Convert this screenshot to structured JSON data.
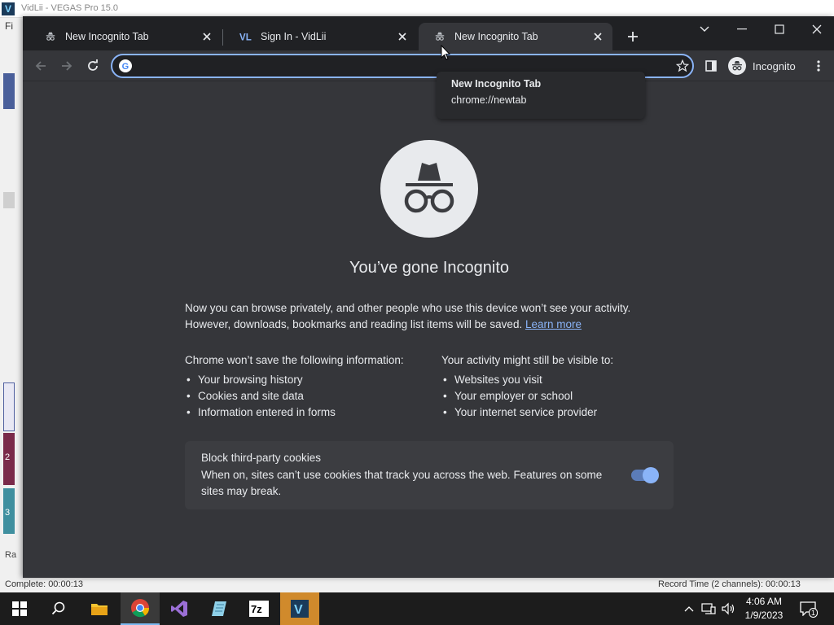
{
  "background_app": {
    "title": "VidLii - VEGAS Pro 15.0",
    "menu_letter": "Fi",
    "status_left": "Complete: 00:00:13",
    "status_right": "Record Time (2 channels): 00:00:13",
    "track_numbers": [
      "2",
      "3"
    ],
    "bottom_letter": "Ra"
  },
  "browser": {
    "tabs": [
      {
        "label": "New Incognito Tab",
        "icon": "incognito-icon",
        "active": false
      },
      {
        "label": "Sign In - VidLii",
        "icon": "vidlii-icon",
        "active": false
      },
      {
        "label": "New Incognito Tab",
        "icon": "incognito-icon",
        "active": true
      }
    ],
    "omnibox": {
      "value": "",
      "placeholder": ""
    },
    "profile_label": "Incognito",
    "tooltip": {
      "title": "New Incognito Tab",
      "url": "chrome://newtab"
    }
  },
  "page": {
    "heading": "You’ve gone Incognito",
    "intro_text": "Now you can browse privately, and other people who use this device won’t see your activity. However, downloads, bookmarks and reading list items will be saved.",
    "learn_more": "Learn more",
    "left_column": {
      "heading": "Chrome won’t save the following information:",
      "items": [
        "Your browsing history",
        "Cookies and site data",
        "Information entered in forms"
      ]
    },
    "right_column": {
      "heading": "Your activity might still be visible to:",
      "items": [
        "Websites you visit",
        "Your employer or school",
        "Your internet service provider"
      ]
    },
    "cookie_card": {
      "title": "Block third-party cookies",
      "description": "When on, sites can’t use cookies that track you across the web. Features on some sites may break.",
      "toggle_on": true
    }
  },
  "taskbar": {
    "apps": [
      "start",
      "search",
      "file-explorer",
      "chrome",
      "visual-studio",
      "notepad",
      "7zip",
      "vegas"
    ],
    "clock_time": "4:06 AM",
    "clock_date": "1/9/2023",
    "notification_count": "1"
  },
  "colors": {
    "tabstrip": "#202124",
    "toolbar": "#35363a",
    "accent": "#8ab4f8",
    "text": "#e8eaed"
  }
}
